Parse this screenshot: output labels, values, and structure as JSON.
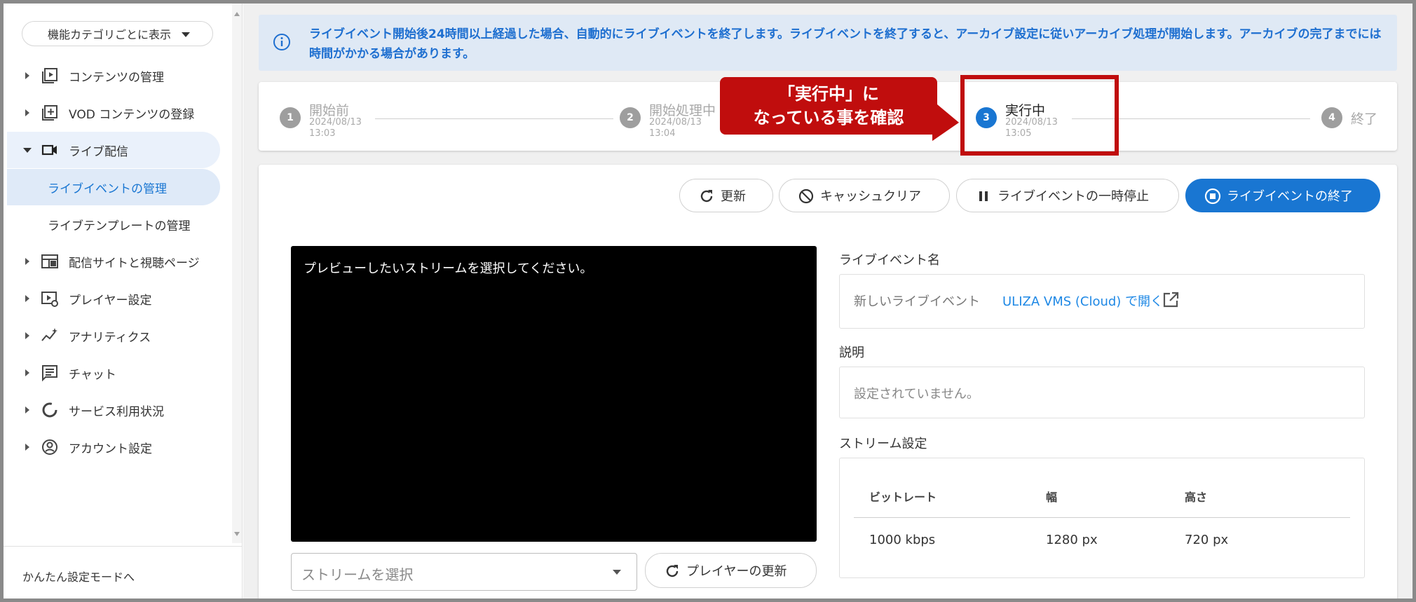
{
  "notice": {
    "message": "ライブイベント開始後24時間以上経過した場合、自動的にライブイベントを終了します。ライブイベントを終了すると、アーカイブ設定に従いアーカイブ処理が開始します。アーカイブの完了までには時間がかかる場合があります。"
  },
  "sidebar": {
    "category_select": "機能カテゴリごとに表示",
    "items": [
      {
        "label": "コンテンツの管理",
        "icon": "video-library-icon"
      },
      {
        "label": "VOD コンテンツの登録",
        "icon": "add-box-icon"
      },
      {
        "label": "ライブ配信",
        "icon": "videocam-icon"
      },
      {
        "label": "配信サイトと視聴ページ",
        "icon": "web-icon"
      },
      {
        "label": "プレイヤー設定",
        "icon": "player-settings-icon"
      },
      {
        "label": "アナリティクス",
        "icon": "analytics-icon"
      },
      {
        "label": "チャット",
        "icon": "chat-icon"
      },
      {
        "label": "サービス利用状況",
        "icon": "donut-chart-icon"
      },
      {
        "label": "アカウント設定",
        "icon": "account-circle-icon"
      }
    ],
    "sub_items": [
      {
        "label": "ライブイベントの管理"
      },
      {
        "label": "ライブテンプレートの管理"
      }
    ],
    "footer": "かんたん設定モードへ"
  },
  "stepper": {
    "steps": [
      {
        "num": "1",
        "title": "開始前",
        "date": "2024/08/13",
        "time": "13:03"
      },
      {
        "num": "2",
        "title": "開始処理中",
        "date": "2024/08/13",
        "time": "13:04"
      },
      {
        "num": "3",
        "title": "実行中",
        "date": "2024/08/13",
        "time": "13:05"
      },
      {
        "num": "4",
        "title": "終了"
      }
    ]
  },
  "callout": {
    "line1": "「実行中」に",
    "line2": "なっている事を確認"
  },
  "toolbar": {
    "refresh": "更新",
    "cache_clear": "キャッシュクリア",
    "pause": "ライブイベントの一時停止",
    "end": "ライブイベントの終了"
  },
  "preview": {
    "placeholder": "プレビューしたいストリームを選択してください。",
    "stream_select": "ストリームを選択",
    "player_refresh": "プレイヤーの更新"
  },
  "details": {
    "event_name_label": "ライブイベント名",
    "event_name": "新しいライブイベント",
    "open_link": "ULIZA VMS (Cloud) で開く",
    "description_label": "説明",
    "description": "設定されていません。",
    "stream_settings_label": "ストリーム設定",
    "table": {
      "headers": [
        "ビットレート",
        "幅",
        "高さ"
      ],
      "row": [
        "1000 kbps",
        "1280 px",
        "720 px"
      ]
    }
  },
  "colors": {
    "accent": "#1976d2",
    "callout": "#c00d0d",
    "notice_bg": "#dfe9f5"
  }
}
